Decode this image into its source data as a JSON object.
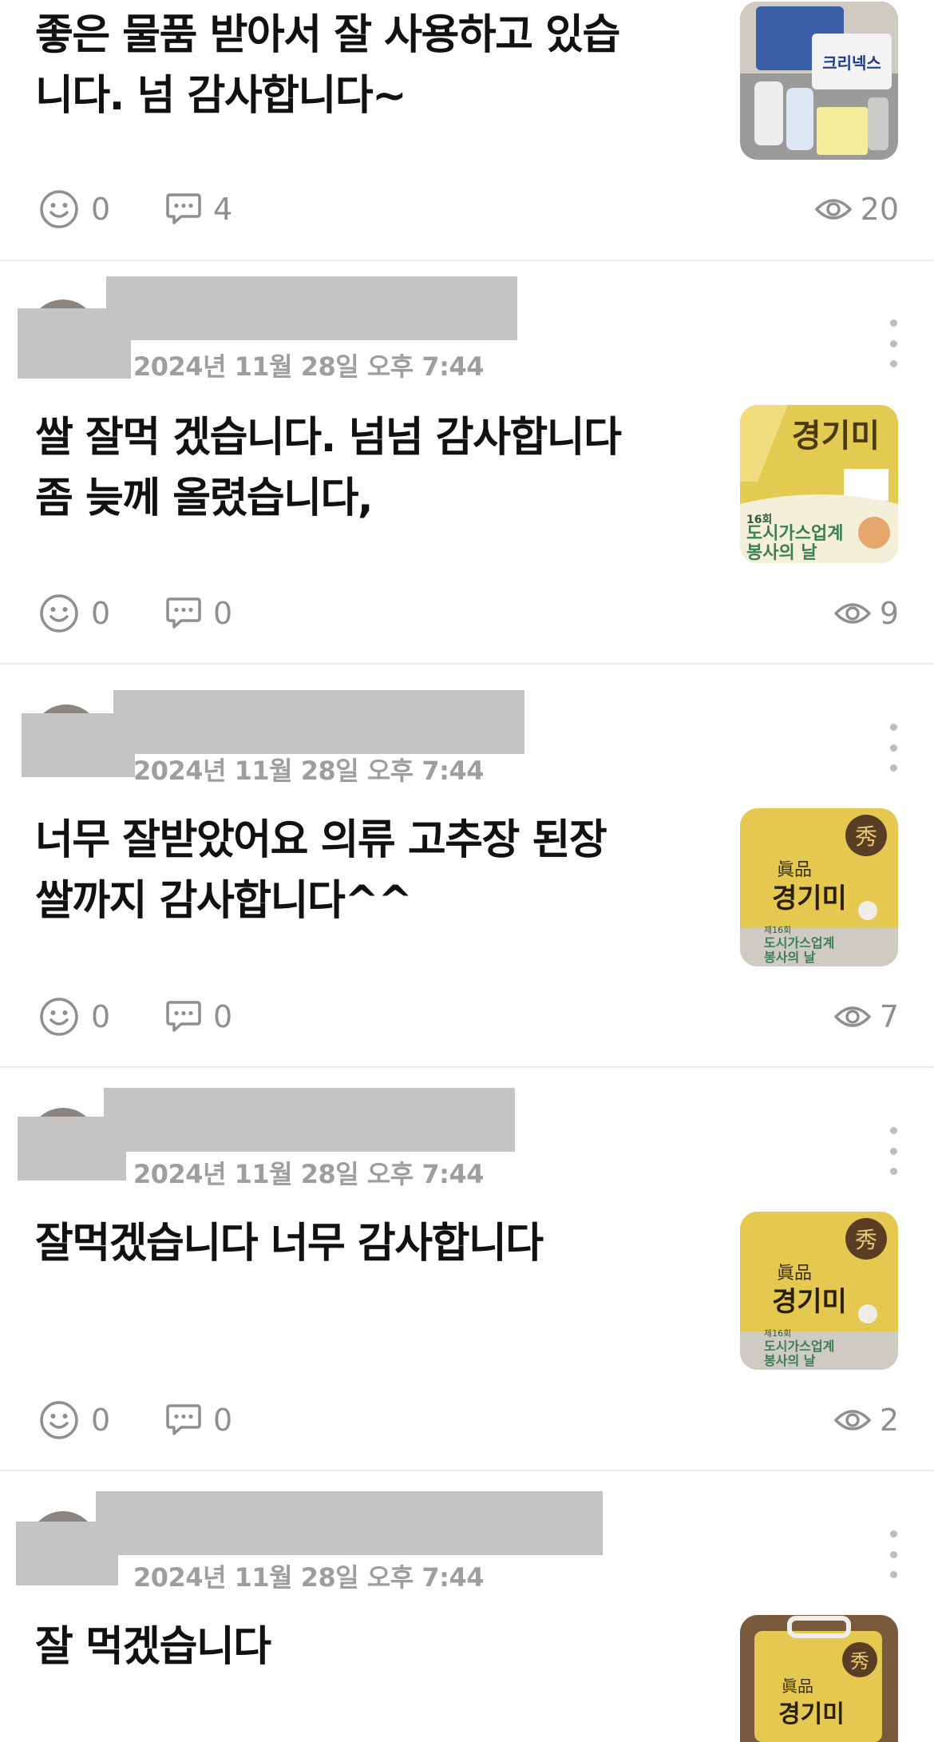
{
  "posts": [
    {
      "timestamp": "",
      "text_lines": [
        "좋은 물품 받아서 잘 사용하고 있습",
        "니다. 넘 감사합니다~"
      ],
      "thumbnail": {
        "icon": "product-photo-cleaning-supplies",
        "bg": "#9a9a98",
        "labels": [
          "크리넥스"
        ]
      },
      "reactions": "0",
      "comments": "4",
      "views": "20"
    },
    {
      "timestamp": "2024년 11월 28일 오후 7:44",
      "text_lines": [
        "쌀 잘먹 겠습니다. 넘넘 감사합니다",
        "좀 늦께 올렸습니다,"
      ],
      "thumbnail": {
        "icon": "product-photo-rice-bag",
        "bg": "#e3cb52",
        "labels": [
          "경기미",
          "16회",
          "도시가스업계",
          "봉사의 날"
        ]
      },
      "reactions": "0",
      "comments": "0",
      "views": "9"
    },
    {
      "timestamp": "2024년 11월 28일 오후 7:44",
      "text_lines": [
        "너무 잘받았어요 의류 고추장 된장",
        "쌀까지 감사합니다^^"
      ],
      "thumbnail": {
        "icon": "product-photo-rice-bag",
        "bg": "#e4c850",
        "labels": [
          "眞品",
          "경기미",
          "제16회",
          "도시가스업계",
          "봉사의 날",
          "秀"
        ]
      },
      "reactions": "0",
      "comments": "0",
      "views": "7"
    },
    {
      "timestamp": "2024년 11월 28일 오후 7:44",
      "text_lines": [
        "잘먹겠습니다 너무 감사합니다"
      ],
      "thumbnail": {
        "icon": "product-photo-rice-bag",
        "bg": "#e4c850",
        "labels": [
          "眞品",
          "경기미",
          "제16회",
          "도시가스업계",
          "봉사의 날",
          "秀"
        ]
      },
      "reactions": "0",
      "comments": "0",
      "views": "2"
    },
    {
      "timestamp": "2024년 11월 28일 오후 7:44",
      "text_lines": [
        "잘 먹겠습니다"
      ],
      "thumbnail": {
        "icon": "product-photo-rice-bag",
        "bg": "#7a5a3c",
        "labels": [
          "眞品",
          "경기미",
          "秀"
        ]
      }
    }
  ]
}
